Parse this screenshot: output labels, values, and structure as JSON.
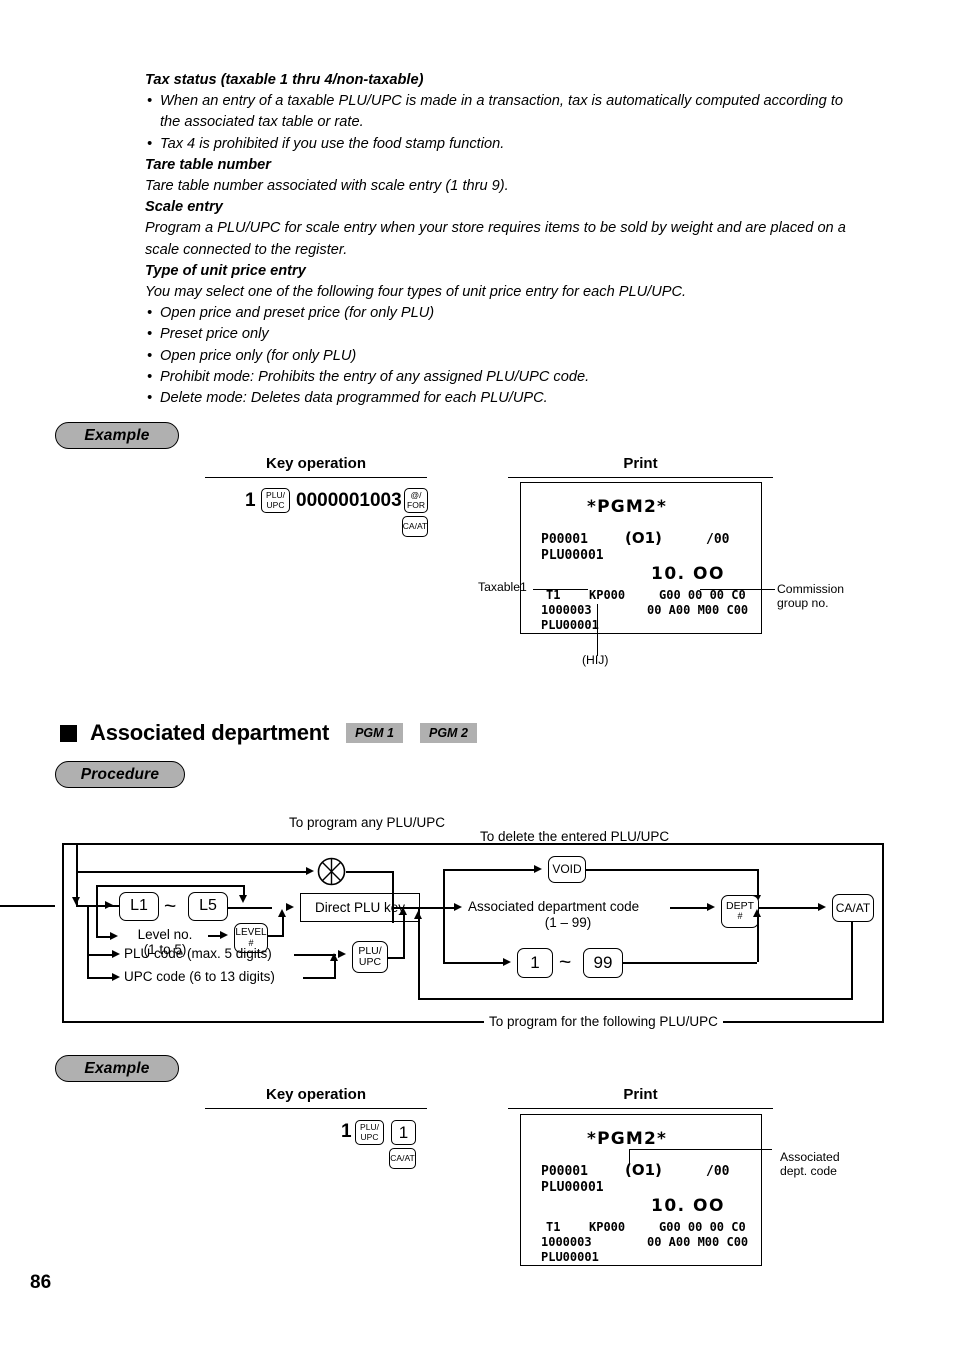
{
  "page": {
    "number": "86"
  },
  "intro": {
    "blocks": [
      {
        "kind": "heading",
        "text": "Tax status (taxable 1 thru 4/non-taxable)"
      },
      {
        "kind": "bullet",
        "text": "When an entry of a taxable PLU/UPC is made in a transaction, tax is automatically computed according to the associated tax table or rate."
      },
      {
        "kind": "bullet",
        "text": "Tax 4 is prohibited if you use the food stamp function."
      },
      {
        "kind": "heading",
        "text": "Tare table number"
      },
      {
        "kind": "para",
        "text": "Tare table number associated with scale entry (1 thru 9)."
      },
      {
        "kind": "heading",
        "text": "Scale entry"
      },
      {
        "kind": "para",
        "text": "Program a PLU/UPC for scale entry when your store requires items to be sold by weight and are placed on a scale connected to the register."
      },
      {
        "kind": "heading",
        "text": "Type of unit price entry"
      },
      {
        "kind": "para",
        "text": "You may select one of the following four types of unit price entry for each PLU/UPC."
      },
      {
        "kind": "bullet",
        "text": "Open price and preset price (for only PLU)"
      },
      {
        "kind": "bullet",
        "text": "Preset price only"
      },
      {
        "kind": "bullet",
        "text": "Open price only (for only PLU)"
      },
      {
        "kind": "bullet",
        "text": "Prohibit mode: Prohibits the entry of any assigned PLU/UPC code."
      },
      {
        "kind": "bullet",
        "text": "Delete mode: Deletes data programmed for each PLU/UPC."
      }
    ]
  },
  "example1": {
    "pill_label": "Example",
    "key_operation_header": "Key operation",
    "print_header": "Print",
    "keys": {
      "leading_digit": "1",
      "plu_upc_line1": "PLU/",
      "plu_upc_line2": "UPC",
      "code": "0000001003",
      "at_for_line1": "@/",
      "at_for_line2": "FOR",
      "ca_at": "CA/AT"
    },
    "receipt": {
      "title": "*PGM2*",
      "line1_left": "P00001",
      "line1_mid": "(O1)",
      "line1_right": "/00",
      "line2": "PLU00001",
      "amount": "10. OO",
      "line3_a": "T1",
      "line3_b": "KP000",
      "line3_c": "G00 00 00 C0",
      "line4_a": "1000003",
      "line4_c": "00 A00 M00 C00",
      "line5": "PLU00001"
    },
    "callouts": {
      "left": "Taxable1",
      "right_line1": "Commission",
      "right_line2": "group no.",
      "bottom": "(HIJ)"
    }
  },
  "section": {
    "title": "Associated department",
    "tags": [
      "PGM 1",
      "PGM 2"
    ],
    "procedure_label": "Procedure"
  },
  "flow": {
    "top_label": "To program any PLU/UPC",
    "delete_label": "To delete the entered PLU/UPC",
    "bottom_label": "To program for the following PLU/UPC",
    "level_low": "L1",
    "level_high": "L5",
    "tilde": "~",
    "level_no_line1": "Level no.",
    "level_no_line2": "(1 to 5)",
    "level_key_line1": "LEVEL",
    "level_key_line2": "#",
    "direct_plu_key": "Direct PLU key",
    "plu_code": "PLU code (max. 5 digits)",
    "upc_code": "UPC code (6 to 13 digits)",
    "plu_upc_key_line1": "PLU/",
    "plu_upc_key_line2": "UPC",
    "void_key": "VOID",
    "assoc_dept_line1": "Associated department code",
    "assoc_dept_line2": "(1 – 99)",
    "dept_key_line1": "DEPT",
    "dept_key_line2": "#",
    "dept_low": "1",
    "dept_high": "99",
    "ca_at_key": "CA/AT"
  },
  "example2": {
    "pill_label": "Example",
    "key_operation_header": "Key operation",
    "print_header": "Print",
    "keys": {
      "leading_digit": "1",
      "plu_upc_line1": "PLU/",
      "plu_upc_line2": "UPC",
      "dept": "1",
      "ca_at": "CA/AT"
    },
    "receipt": {
      "title": "*PGM2*",
      "line1_left": "P00001",
      "line1_mid": "(O1)",
      "line1_right": "/00",
      "line2": "PLU00001",
      "amount": "10. OO",
      "line3_a": "T1",
      "line3_b": "KP000",
      "line3_c": "G00 00 00 C0",
      "line4_a": "1000003",
      "line4_c": "00 A00 M00 C00",
      "line5": "PLU00001"
    },
    "callouts": {
      "right_line1": "Associated",
      "right_line2": "dept. code"
    }
  }
}
